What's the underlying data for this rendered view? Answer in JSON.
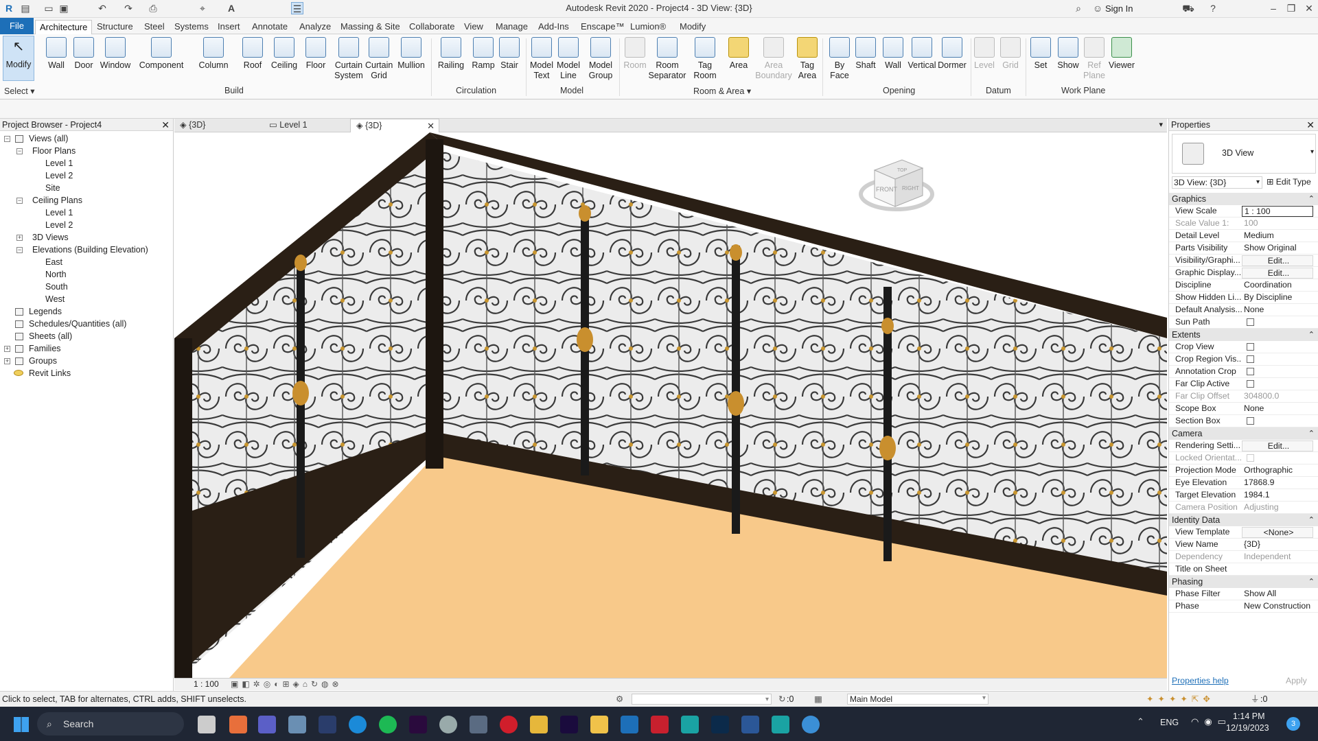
{
  "app": {
    "title": "Autodesk Revit 2020 - Project4 - 3D View: {3D}",
    "sign_in": "Sign In"
  },
  "menu": {
    "tabs": [
      "File",
      "Architecture",
      "Structure",
      "Steel",
      "Systems",
      "Insert",
      "Annotate",
      "Analyze",
      "Massing & Site",
      "Collaborate",
      "View",
      "Manage",
      "Add-Ins",
      "Enscape™",
      "Lumion®",
      "Modify"
    ]
  },
  "ribbon": {
    "tools": [
      {
        "label": "Modify"
      },
      {
        "label": "Wall"
      },
      {
        "label": "Door"
      },
      {
        "label": "Window"
      },
      {
        "label": "Component"
      },
      {
        "label": "Column"
      },
      {
        "label": "Roof"
      },
      {
        "label": "Ceiling"
      },
      {
        "label": "Floor"
      },
      {
        "label": "Curtain\nSystem"
      },
      {
        "label": "Curtain\nGrid"
      },
      {
        "label": "Mullion"
      },
      {
        "label": "Railing"
      },
      {
        "label": "Ramp"
      },
      {
        "label": "Stair"
      },
      {
        "label": "Model\nText"
      },
      {
        "label": "Model\nLine"
      },
      {
        "label": "Model\nGroup"
      },
      {
        "label": "Room"
      },
      {
        "label": "Room\nSeparator"
      },
      {
        "label": "Tag\nRoom"
      },
      {
        "label": "Area"
      },
      {
        "label": "Area\nBoundary"
      },
      {
        "label": "Tag\nArea"
      },
      {
        "label": "By\nFace"
      },
      {
        "label": "Shaft"
      },
      {
        "label": "Wall"
      },
      {
        "label": "Vertical"
      },
      {
        "label": "Dormer"
      },
      {
        "label": "Level"
      },
      {
        "label": "Grid"
      },
      {
        "label": "Set"
      },
      {
        "label": "Show"
      },
      {
        "label": "Ref\nPlane"
      },
      {
        "label": "Viewer"
      }
    ],
    "panels": [
      "Select",
      "Build",
      "Circulation",
      "Model",
      "Room & Area",
      "Opening",
      "Datum",
      "Work Plane"
    ]
  },
  "browser": {
    "title": "Project Browser - Project4",
    "items": [
      "Views (all)",
      "Floor Plans",
      "Level 1",
      "Level 2",
      "Site",
      "Ceiling Plans",
      "Level 1",
      "Level 2",
      "3D Views",
      "Elevations (Building Elevation)",
      "East",
      "North",
      "South",
      "West",
      "Legends",
      "Schedules/Quantities (all)",
      "Sheets (all)",
      "Families",
      "Groups",
      "Revit Links"
    ]
  },
  "viewtabs": [
    "{3D}",
    "Level 1",
    "{3D}"
  ],
  "viewbar": {
    "scale": "1 : 100"
  },
  "props": {
    "title": "Properties",
    "type_name": "3D View",
    "selector": "3D View: {3D}",
    "edit_type": "Edit Type",
    "sections": {
      "graphics": "Graphics",
      "extents": "Extents",
      "camera": "Camera",
      "identity": "Identity Data",
      "phasing": "Phasing"
    },
    "rows": [
      {
        "k": "View Scale",
        "v": "1 : 100"
      },
      {
        "k": "Scale Value    1:",
        "v": "100"
      },
      {
        "k": "Detail Level",
        "v": "Medium"
      },
      {
        "k": "Parts Visibility",
        "v": "Show Original"
      },
      {
        "k": "Visibility/Graphi...",
        "v": "Edit..."
      },
      {
        "k": "Graphic Display...",
        "v": "Edit..."
      },
      {
        "k": "Discipline",
        "v": "Coordination"
      },
      {
        "k": "Show Hidden Li...",
        "v": "By Discipline"
      },
      {
        "k": "Default Analysis...",
        "v": "None"
      },
      {
        "k": "Sun Path",
        "v": ""
      },
      {
        "k": "Crop View",
        "v": ""
      },
      {
        "k": "Crop Region Vis...",
        "v": ""
      },
      {
        "k": "Annotation Crop",
        "v": ""
      },
      {
        "k": "Far Clip Active",
        "v": ""
      },
      {
        "k": "Far Clip Offset",
        "v": "304800.0"
      },
      {
        "k": "Scope Box",
        "v": "None"
      },
      {
        "k": "Section Box",
        "v": ""
      },
      {
        "k": "Rendering Setti...",
        "v": "Edit..."
      },
      {
        "k": "Locked Orientat...",
        "v": ""
      },
      {
        "k": "Projection Mode",
        "v": "Orthographic"
      },
      {
        "k": "Eye Elevation",
        "v": "17868.9"
      },
      {
        "k": "Target Elevation",
        "v": "1984.1"
      },
      {
        "k": "Camera Position",
        "v": "Adjusting"
      },
      {
        "k": "View Template",
        "v": "<None>"
      },
      {
        "k": "View Name",
        "v": "{3D}"
      },
      {
        "k": "Dependency",
        "v": "Independent"
      },
      {
        "k": "Title on Sheet",
        "v": ""
      },
      {
        "k": "Phase Filter",
        "v": "Show All"
      },
      {
        "k": "Phase",
        "v": "New Construction"
      }
    ],
    "help": "Properties help",
    "apply": "Apply"
  },
  "status": {
    "hint": "Click to select, TAB for alternates, CTRL adds, SHIFT unselects.",
    "filter_count": ":0",
    "model": "Main Model",
    "sel_count": ":0"
  },
  "taskbar": {
    "search": "Search",
    "lang": "ENG",
    "time": "1:14 PM",
    "date": "12/19/2023",
    "notif": "3"
  },
  "viewcube": {
    "top": "TOP",
    "front": "FRONT",
    "right": "RIGHT"
  },
  "colors": {
    "accent": "#1d6fb8",
    "rail": "#2a1f15",
    "floor": "#f8c98a",
    "taskbar": "#1f2634"
  }
}
